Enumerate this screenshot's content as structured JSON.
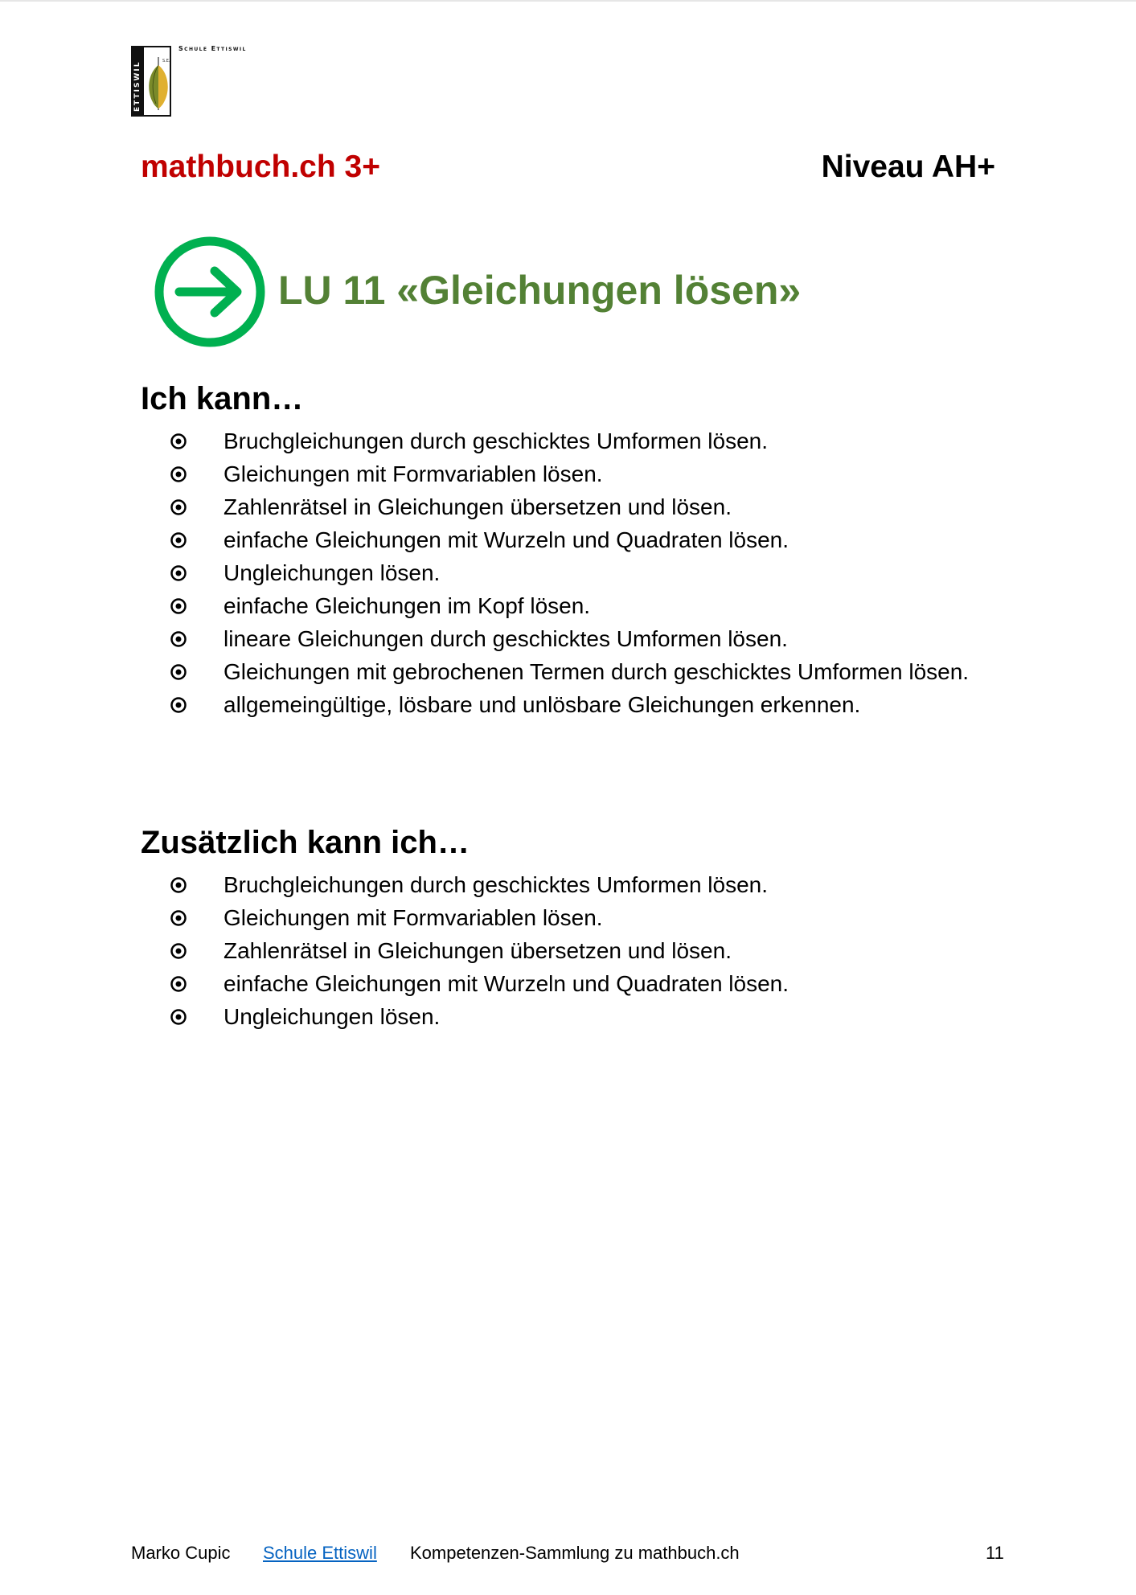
{
  "header": {
    "school_name": "Schule Ettiswil",
    "logo_band_text": "ETTISWIL",
    "brand_title": "mathbuch.ch 3+",
    "niveau": "Niveau AH+"
  },
  "unit": {
    "title": "LU 11 «Gleichungen lösen»",
    "icon": "arrow-right-circle-icon"
  },
  "sections": [
    {
      "heading": "Ich kann…",
      "items": [
        "Bruchgleichungen durch geschicktes Umformen lösen.",
        "Gleichungen mit Formvariablen lösen.",
        "Zahlenrätsel in Gleichungen übersetzen und lösen.",
        "einfache Gleichungen mit Wurzeln und Quadraten lösen.",
        "Ungleichungen lösen.",
        "einfache Gleichungen im Kopf lösen.",
        "lineare Gleichungen durch geschicktes Umformen lösen.",
        "Gleichungen mit gebrochenen Termen durch geschicktes Umformen lösen.",
        "allgemeingültige, lösbare und unlösbare Gleichungen erkennen."
      ]
    },
    {
      "heading": "Zusätzlich kann ich…",
      "items": [
        "Bruchgleichungen durch geschicktes Umformen lösen.",
        "Gleichungen mit Formvariablen lösen.",
        "Zahlenrätsel in Gleichungen übersetzen und lösen.",
        "einfache Gleichungen mit Wurzeln und Quadraten lösen.",
        "Ungleichungen lösen."
      ]
    }
  ],
  "footer": {
    "author": "Marko Cupic",
    "link_text": "Schule Ettiswil",
    "collection": "Kompetenzen-Sammlung zu mathbuch.ch",
    "page_number": "11"
  },
  "colors": {
    "brand_red": "#c00000",
    "title_green": "#538135",
    "icon_green": "#00b050",
    "link_blue": "#0563c1"
  }
}
